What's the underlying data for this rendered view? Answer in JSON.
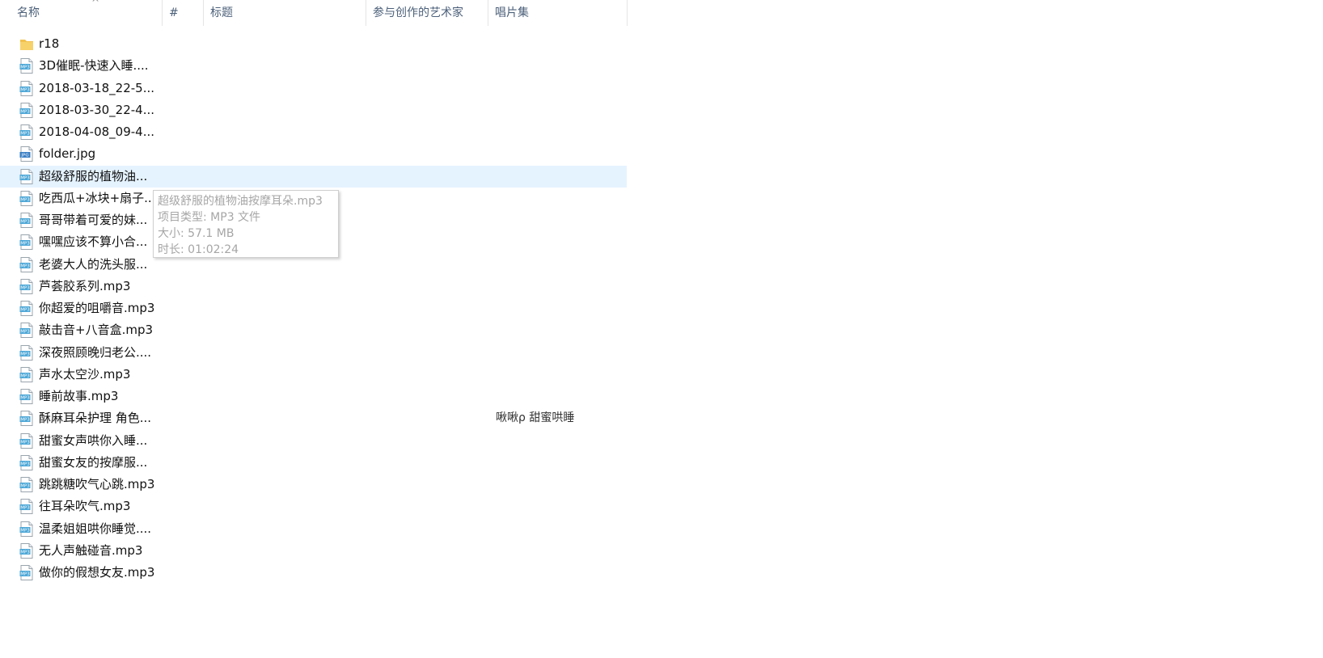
{
  "columns": {
    "name": "名称",
    "number": "#",
    "title": "标题",
    "artist": "参与创作的艺术家",
    "album": "唱片集"
  },
  "sort_indicator": "^",
  "rows": [
    {
      "name": "r18",
      "icon": "folder-icon",
      "album": ""
    },
    {
      "name": "3D催眠-快速入睡....",
      "icon": "mp3-file-icon",
      "album": ""
    },
    {
      "name": "2018-03-18_22-5...",
      "icon": "mp3-file-icon",
      "album": ""
    },
    {
      "name": "2018-03-30_22-4...",
      "icon": "mp3-file-icon",
      "album": ""
    },
    {
      "name": "2018-04-08_09-4...",
      "icon": "mp3-file-icon",
      "album": ""
    },
    {
      "name": "folder.jpg",
      "icon": "jpg-file-icon",
      "album": ""
    },
    {
      "name": "超级舒服的植物油...",
      "icon": "mp3-file-icon",
      "album": ""
    },
    {
      "name": "吃西瓜+冰块+扇子...",
      "icon": "mp3-file-icon",
      "album": ""
    },
    {
      "name": "哥哥带着可爱的妹...",
      "icon": "mp3-file-icon",
      "album": ""
    },
    {
      "name": "嘿嘿应该不算小合...",
      "icon": "mp3-file-icon",
      "album": ""
    },
    {
      "name": "老婆大人的洗头服...",
      "icon": "mp3-file-icon",
      "album": ""
    },
    {
      "name": "芦荟胶系列.mp3",
      "icon": "mp3-file-icon",
      "album": ""
    },
    {
      "name": "你超爱的咀嚼音.mp3",
      "icon": "mp3-file-icon",
      "album": ""
    },
    {
      "name": "敲击音+八音盒.mp3",
      "icon": "mp3-file-icon",
      "album": ""
    },
    {
      "name": "深夜照顾晚归老公....",
      "icon": "mp3-file-icon",
      "album": ""
    },
    {
      "name": "声水太空沙.mp3",
      "icon": "mp3-file-icon",
      "album": ""
    },
    {
      "name": "睡前故事.mp3",
      "icon": "mp3-file-icon",
      "album": ""
    },
    {
      "name": "酥麻耳朵护理 角色...",
      "icon": "mp3-file-icon",
      "album": "啾啾ρ 甜蜜哄睡"
    },
    {
      "name": "甜蜜女声哄你入睡...",
      "icon": "mp3-file-icon",
      "album": ""
    },
    {
      "name": "甜蜜女友的按摩服...",
      "icon": "mp3-file-icon",
      "album": ""
    },
    {
      "name": "跳跳糖吹气心跳.mp3",
      "icon": "mp3-file-icon",
      "album": ""
    },
    {
      "name": "往耳朵吹气.mp3",
      "icon": "mp3-file-icon",
      "album": ""
    },
    {
      "name": "温柔姐姐哄你睡觉....",
      "icon": "mp3-file-icon",
      "album": ""
    },
    {
      "name": "无人声触碰音.mp3",
      "icon": "mp3-file-icon",
      "album": ""
    },
    {
      "name": "做你的假想女友.mp3",
      "icon": "mp3-file-icon",
      "album": ""
    }
  ],
  "hovered_row": 6,
  "tooltip": {
    "filename": "超级舒服的植物油按摩耳朵.mp3",
    "type": "项目类型: MP3 文件",
    "size": "大小: 57.1 MB",
    "duration": "时长: 01:02:24"
  },
  "colors": {
    "hover_bg": "#e5f3ff",
    "header_text": "#4c607a",
    "tooltip_text": "#a6a6a6",
    "folder": "#f2c14e",
    "mp3_icon": "#4ba6d6"
  }
}
